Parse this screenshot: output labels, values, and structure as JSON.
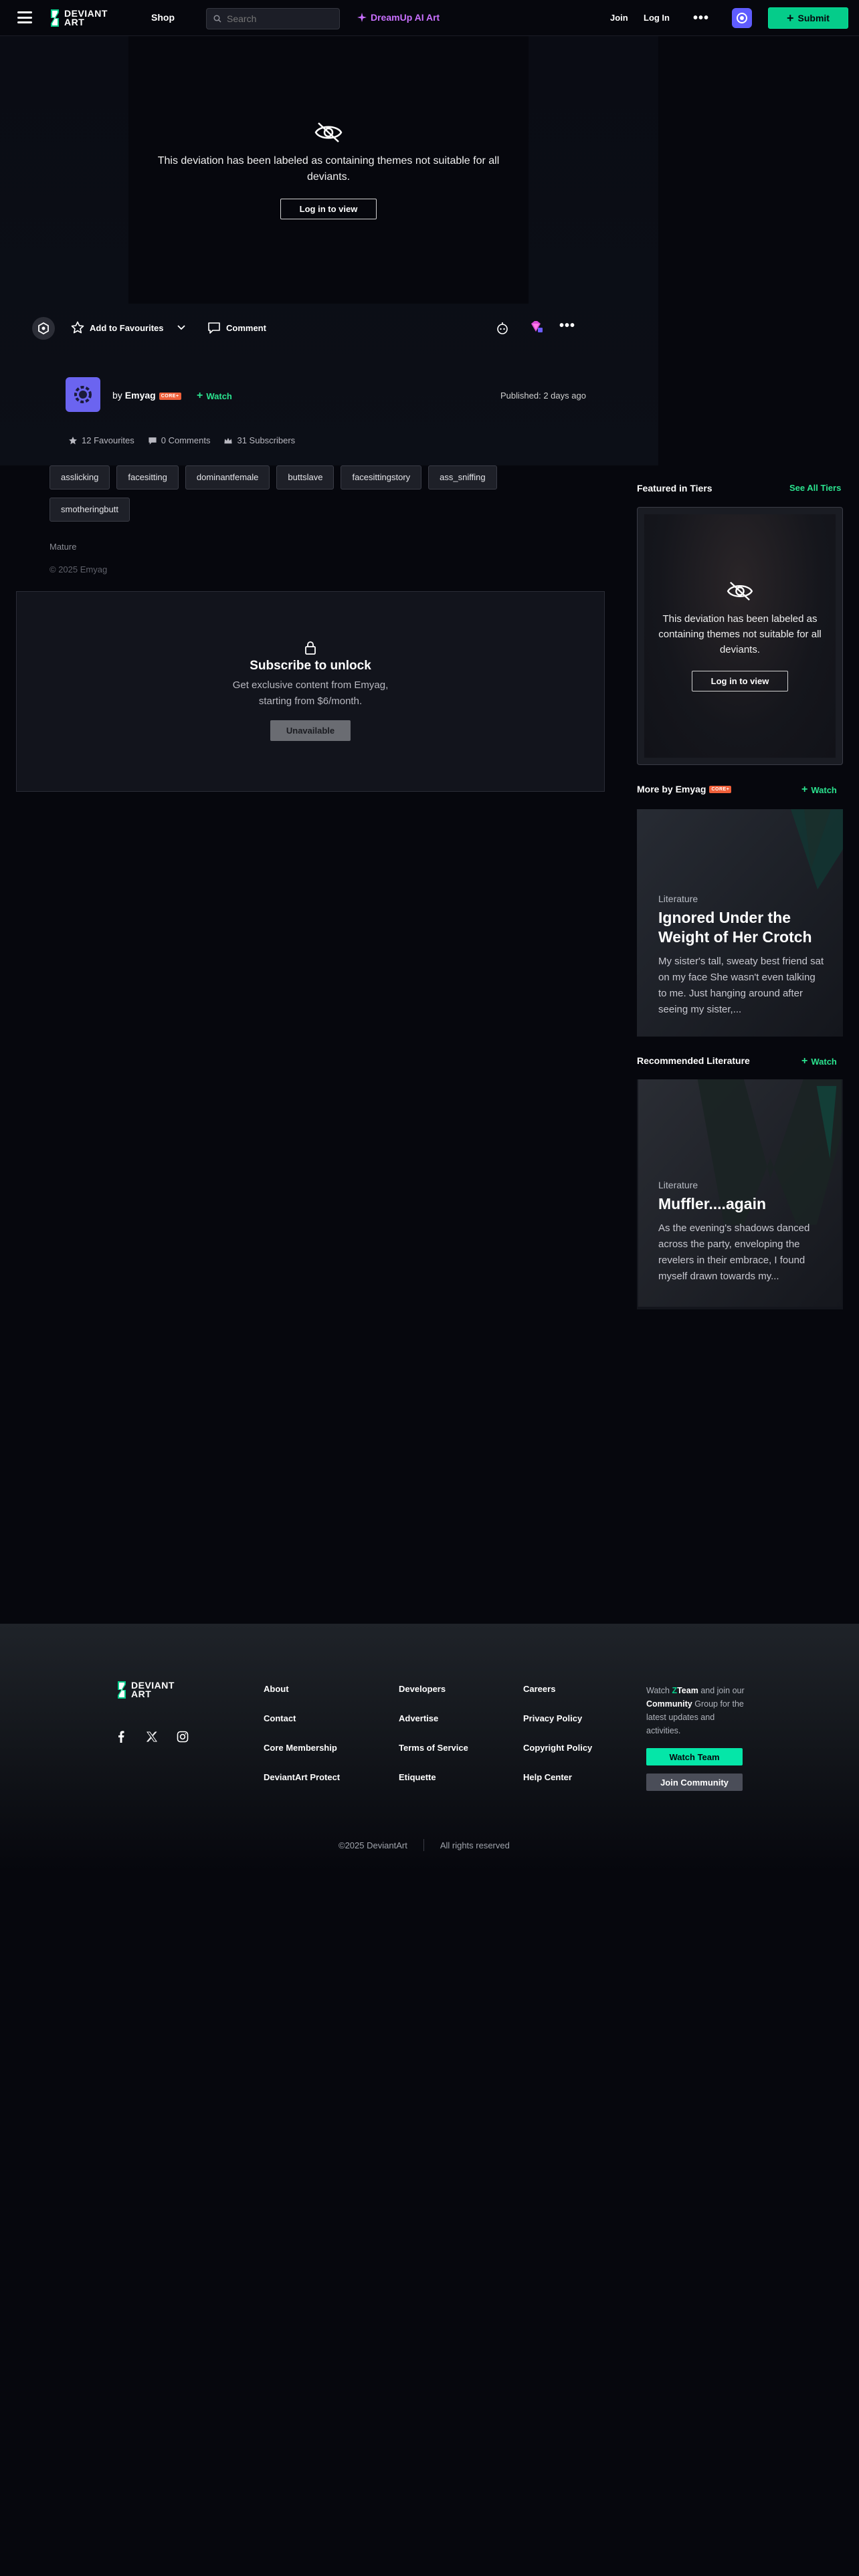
{
  "header": {
    "logo_text_1": "DEVIANT",
    "logo_text_2": "ART",
    "shop": "Shop",
    "search_placeholder": "Search",
    "dreamup": "DreamUp AI Art",
    "join": "Join",
    "login": "Log In",
    "submit": "Submit"
  },
  "deviation": {
    "mature_message": "This deviation has been labeled as containing themes not suitable for all deviants.",
    "login_button": "Log in to view",
    "add_fav": "Add to Favourites",
    "comment": "Comment",
    "by": "by",
    "author": "Emyag",
    "core_badge": "CORE+",
    "watch": "Watch",
    "published": "Published: 2 days ago",
    "stats": {
      "favourites": "12 Favourites",
      "comments": "0 Comments",
      "subscribers": "31 Subscribers"
    },
    "tags": [
      "asslicking",
      "facesitting",
      "dominantfemale",
      "buttslave",
      "facesittingstory",
      "ass_sniffing",
      "smotheringbutt"
    ],
    "mature_label": "Mature",
    "copyright": "© 2025 Emyag"
  },
  "subscribe": {
    "title": "Subscribe to unlock",
    "desc_1": "Get exclusive content from Emyag,",
    "desc_2": "starting from $6/month.",
    "button": "Unavailable"
  },
  "sidebar": {
    "featured_title": "Featured in Tiers",
    "see_all": "See All Tiers",
    "tier_message": "This deviation has been labeled as containing themes not suitable for all deviants.",
    "tier_button": "Log in to view",
    "more_by": "More by Emyag",
    "more_badge": "CORE+",
    "watch": "Watch",
    "more_card": {
      "category": "Literature",
      "title": "Ignored Under the Weight of Her Crotch",
      "excerpt": "My sister's tall, sweaty best friend sat on my face She wasn't even talking to me. Just hanging around after seeing my sister,..."
    },
    "recommended": "Recommended Literature",
    "rec_watch": "Watch",
    "rec_card": {
      "category": "Literature",
      "title": "Muffler....again",
      "excerpt": "As the evening's shadows danced across the party, enveloping the revelers in their embrace, I found myself drawn towards my..."
    }
  },
  "footer": {
    "col1": [
      "About",
      "Contact",
      "Core Membership",
      "DeviantArt Protect"
    ],
    "col2": [
      "Developers",
      "Advertise",
      "Terms of Service",
      "Etiquette"
    ],
    "col3": [
      "Careers",
      "Privacy Policy",
      "Copyright Policy",
      "Help Center"
    ],
    "watch_1": "Watch",
    "watch_team": "Team",
    "watch_2": "and join our",
    "watch_community": "Community",
    "watch_3": "Group for the latest updates and activities.",
    "watch_team_btn": "Watch Team",
    "join_community_btn": "Join Community",
    "copyright": "©2025 DeviantArt",
    "rights": "All rights reserved"
  },
  "colors": {
    "accent": "#05cc8a",
    "dreamup": "#c970ff",
    "bg": "#06070d"
  }
}
